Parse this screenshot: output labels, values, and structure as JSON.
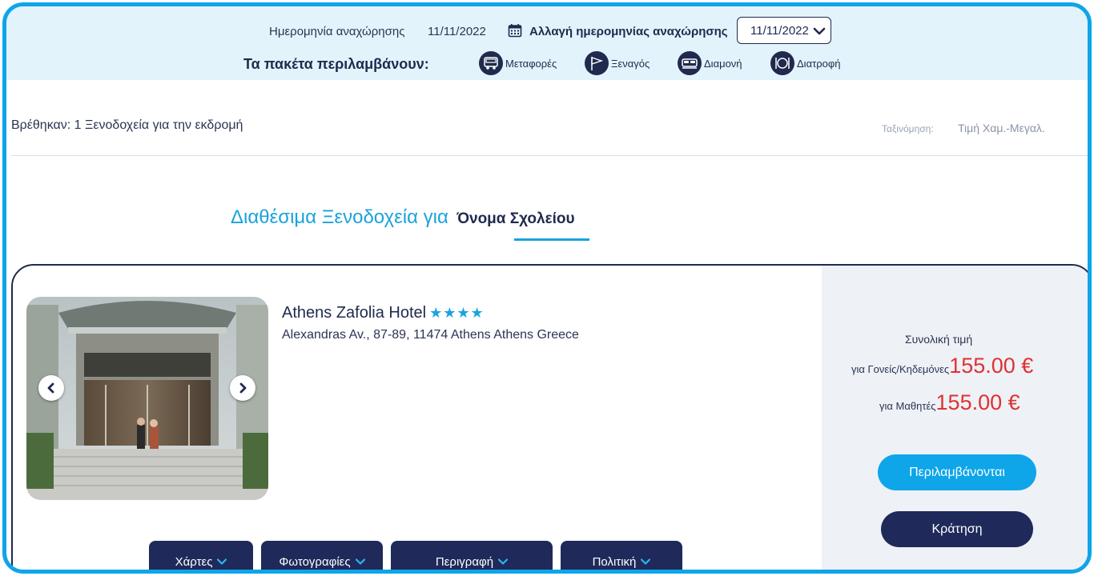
{
  "header": {
    "departure_label": "Ημερομηνία αναχώρησης",
    "departure_date": "11/11/2022",
    "change_label": "Αλλαγή ημερομηνίας αναχώρησης",
    "date_select_value": "11/11/2022",
    "includes_label": "Τα πακέτα περιλαμβάνουν:",
    "features": [
      {
        "icon": "bus-icon",
        "label": "Μεταφορές"
      },
      {
        "icon": "flag-icon",
        "label": "Ξεναγός"
      },
      {
        "icon": "bed-icon",
        "label": "Διαμονή"
      },
      {
        "icon": "dining-icon",
        "label": "Διατροφή"
      }
    ]
  },
  "results": {
    "found_text": "Βρέθηκαν: 1 Ξενοδοχεία για την εκδρομή",
    "sort_label": "Ταξινόμηση:",
    "sort_value": "Τιμή Χαμ.-Μεγαλ."
  },
  "heading": {
    "title": "Διαθέσιμα Ξενοδοχεία για",
    "school": "Όνομα Σχολείου"
  },
  "hotel": {
    "name": "Athens Zafolia Hotel",
    "stars": "★★★★",
    "address": "Alexandras Av., 87-89, 11474 Athens Athens Greece",
    "tabs": [
      "Χάρτες",
      "Φωτογραφίες",
      "Περιγραφή",
      "Πολιτική"
    ]
  },
  "pricing": {
    "total_label": "Συνολική τιμή",
    "parents_label": "για Γονείς/Κηδεμόνες",
    "parents_price": "155.00 €",
    "students_label": "για Μαθητές",
    "students_price": "155.00 €",
    "included_button": "Περιλαμβάνονται",
    "book_button": "Κράτηση"
  },
  "colors": {
    "accent": "#0ea5e9",
    "navy": "#1f2a5a",
    "price": "#e03131",
    "topbar_bg": "#e3f3fb"
  }
}
